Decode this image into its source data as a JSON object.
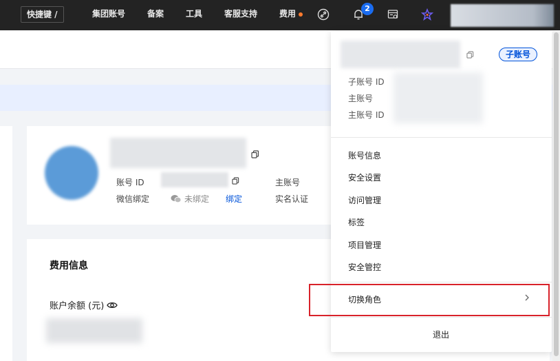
{
  "topbar": {
    "quick_key": "快捷键 /",
    "nav": [
      {
        "label": "集团账号"
      },
      {
        "label": "备案"
      },
      {
        "label": "工具"
      },
      {
        "label": "客服支持"
      },
      {
        "label": "费用"
      }
    ],
    "notification_count": "2",
    "icons": [
      "link-icon",
      "bell-icon",
      "console-icon",
      "logo-icon"
    ]
  },
  "profile_card": {
    "account_id_label": "账号 ID",
    "main_account_label": "主账号",
    "wechat_label": "微信绑定",
    "wechat_status": "未绑定",
    "bind_link": "绑定",
    "realname_label": "实名认证"
  },
  "fee_card": {
    "title": "费用信息",
    "balance_label": "账户余额 (元)"
  },
  "dropdown": {
    "tag": "子账号",
    "meta": [
      {
        "label": "子账号 ID"
      },
      {
        "label": "主账号"
      },
      {
        "label": "主账号 ID"
      }
    ],
    "menu": [
      {
        "label": "账号信息"
      },
      {
        "label": "安全设置"
      },
      {
        "label": "访问管理"
      },
      {
        "label": "标签"
      },
      {
        "label": "项目管理"
      },
      {
        "label": "安全管控"
      }
    ],
    "switch_role": "切换角色",
    "logout": "退出"
  },
  "colors": {
    "topbar_bg": "#232323",
    "accent": "#0052d9",
    "badge": "#1a6cf0",
    "highlight_border": "#d8222a"
  }
}
